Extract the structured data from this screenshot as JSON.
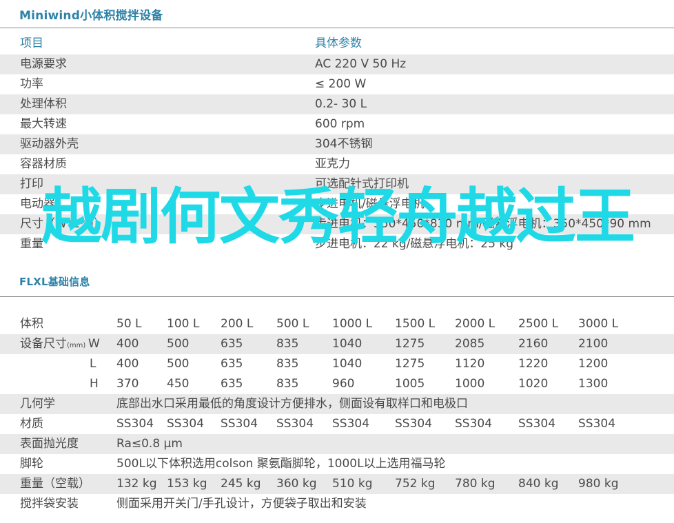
{
  "section1": {
    "title": "Miniwind小体积搅拌设备",
    "header": {
      "item": "项目",
      "param": "具体参数"
    },
    "rows": [
      {
        "label": "电源要求",
        "value": "AC 220  V 50 Hz"
      },
      {
        "label": "功率",
        "value": "≤ 200 W"
      },
      {
        "label": "处理体积",
        "value": "0.2-  30 L"
      },
      {
        "label": "最大转速",
        "value": "600  rpm"
      },
      {
        "label": "驱动器外壳",
        "value": "304不锈钢"
      },
      {
        "label": "容器材质",
        "value": "亚克力"
      },
      {
        "label": "打印",
        "value": "可选配针式打印机"
      },
      {
        "label": "电动器",
        "value": "步进电机/磁悬浮电机"
      },
      {
        "label": "尺寸（W*L*H）",
        "value": "步进电机：350*450*830 mm/磁悬浮电机：350*450*90 mm"
      },
      {
        "label": "重量",
        "value": "步进电机：22 kg/磁悬浮电机：25 kg"
      }
    ]
  },
  "section2": {
    "title": "FLXL基础信息",
    "volume": {
      "label": "体积",
      "values": [
        "50 L",
        "100 L",
        "200 L",
        "500 L",
        "1000 L",
        "1500 L",
        "2000 L",
        "2500 L",
        "3000 L"
      ]
    },
    "size_w": {
      "label": "设备尺寸",
      "unit": "(mm)",
      "dim": "W",
      "values": [
        "400",
        "500",
        "635",
        "835",
        "1040",
        "1275",
        "2085",
        "2160",
        "2100"
      ]
    },
    "size_l": {
      "dim": "L",
      "values": [
        "400",
        "500",
        "635",
        "835",
        "1040",
        "1275",
        "1120",
        "1220",
        "1200"
      ]
    },
    "size_h": {
      "dim": "H",
      "values": [
        "370",
        "450",
        "635",
        "835",
        "960",
        "1005",
        "1000",
        "1020",
        "1300"
      ]
    },
    "geometry": {
      "label": "几何学",
      "value": "底部出水口采用最低的角度设计方便排水，侧面设有取样口和电极口"
    },
    "material": {
      "label": "材质",
      "values": [
        "SS304",
        "SS304",
        "SS304",
        "SS304",
        "SS304",
        "SS304",
        "SS304",
        "SS304",
        "SS304"
      ]
    },
    "polish": {
      "label": "表面抛光度",
      "value": "Ra≤0.8 μm"
    },
    "wheels": {
      "label": "脚轮",
      "value": "500L以下体积选用colson 聚氨酯脚轮，1000L以上选用福马轮"
    },
    "weight": {
      "label": "重量（空载）",
      "values": [
        "132 kg",
        "153 kg",
        "245 kg",
        "360 kg",
        "510 kg",
        "752 kg",
        "780 kg",
        "840 kg",
        "980 kg"
      ]
    },
    "bag": {
      "label": "搅拌袋安装",
      "value": "侧面采用开关门/手孔设计，方便袋子取出和安装"
    }
  },
  "overlay": {
    "text": "越剧何文秀轻舟越过王"
  },
  "colors": {
    "accent": "#2d82a8",
    "overlay": "#1fd9e6",
    "shade": "#e9e9e9"
  }
}
